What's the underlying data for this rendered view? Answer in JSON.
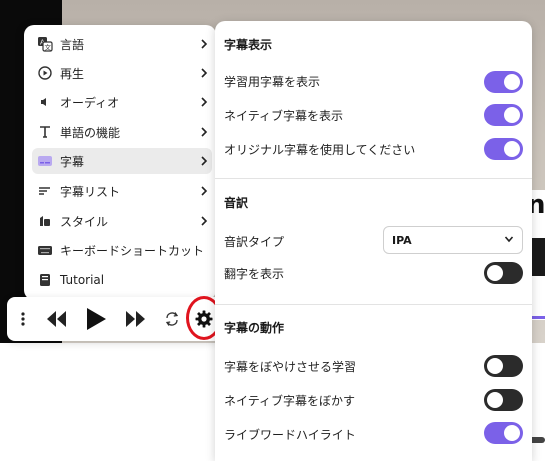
{
  "menu": {
    "items": [
      {
        "label": "言語",
        "icon": "translate-icon",
        "chevron": true,
        "active": false
      },
      {
        "label": "再生",
        "icon": "play-circle-icon",
        "chevron": true,
        "active": false
      },
      {
        "label": "オーディオ",
        "icon": "speaker-icon",
        "chevron": true,
        "active": false
      },
      {
        "label": "単語の機能",
        "icon": "text-t-icon",
        "chevron": true,
        "active": false
      },
      {
        "label": "字幕",
        "icon": "subtitles-icon",
        "chevron": true,
        "active": true
      },
      {
        "label": "字幕リスト",
        "icon": "list-icon",
        "chevron": true,
        "active": false
      },
      {
        "label": "スタイル",
        "icon": "style-icon",
        "chevron": true,
        "active": false
      },
      {
        "label": "キーボードショートカット",
        "icon": "keyboard-icon",
        "chevron": false,
        "active": false
      },
      {
        "label": "Tutorial",
        "icon": "book-icon",
        "chevron": false,
        "active": false
      }
    ]
  },
  "player": {
    "controls": [
      "more-vertical-icon",
      "previous-icon",
      "play-icon",
      "next-icon",
      "repeat-icon",
      "gear-icon"
    ]
  },
  "settings": {
    "subtitles_section": {
      "title": "字幕表示",
      "rows": [
        {
          "label": "学習用字幕を表示",
          "on": true
        },
        {
          "label": "ネイティブ字幕を表示",
          "on": true
        },
        {
          "label": "オリジナル字幕を使用してください",
          "on": true
        }
      ]
    },
    "transliteration_section": {
      "title": "音訳",
      "type_label": "音訳タイプ",
      "type_value": "IPA",
      "show_label": "翻字を表示",
      "show_on": false
    },
    "behavior_section": {
      "title": "字幕の動作",
      "rows": [
        {
          "label": "字幕をぼやけさせる学習",
          "on": false
        },
        {
          "label": "ネイティブ字幕をぼかす",
          "on": false
        },
        {
          "label": "ライブワードハイライト",
          "on": true
        }
      ]
    }
  },
  "video": {
    "subtitle_fragment": "n"
  },
  "colors": {
    "accent": "#7b61e8",
    "toggle_off": "#2b2b2b",
    "highlight_ring": "#e0141e"
  }
}
